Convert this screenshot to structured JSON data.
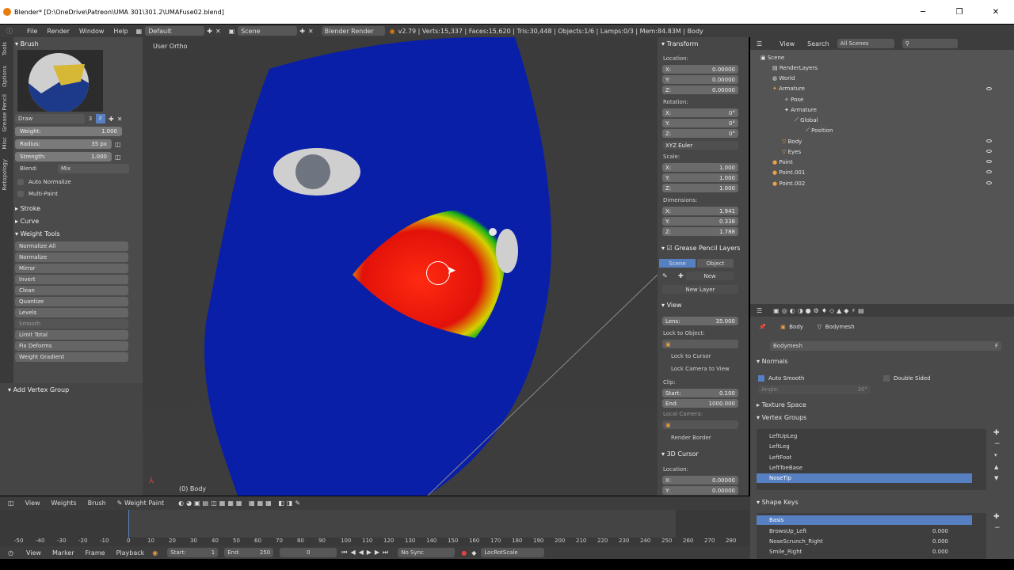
{
  "window": {
    "title": "Blender* [D:\\OneDrive\\Patreon\\UMA 301\\301.2\\UMAFuse02.blend]",
    "minimize": "─",
    "maximize": "❐",
    "close": "✕"
  },
  "menubar": {
    "items": [
      "File",
      "Render",
      "Window",
      "Help"
    ],
    "layout": "Default",
    "scene": "Scene",
    "engine": "Blender Render",
    "stats": "v2.79 | Verts:15,337 | Faces:15,620 | Tris:30,448 | Objects:1/6 | Lamps:0/3 | Mem:84.83M | Body"
  },
  "left_tabs": [
    "Tools",
    "Options",
    "Grease Pencil",
    "Misc",
    "Retopology"
  ],
  "brush": {
    "header": "Brush",
    "name": "Draw",
    "users": "3",
    "fake_user": "F",
    "weight_label": "Weight:",
    "weight": "1.000",
    "radius_label": "Radius:",
    "radius": "35 px",
    "strength_label": "Strength:",
    "strength": "1.000",
    "blend_label": "Blend:",
    "blend": "Mix",
    "auto_normalize": "Auto Normalize",
    "multi_paint": "Multi-Paint"
  },
  "sections": {
    "stroke": "Stroke",
    "curve": "Curve",
    "weight_tools": "Weight Tools",
    "add_vertex_group": "Add Vertex Group"
  },
  "weight_tools": [
    "Normalize All",
    "Normalize",
    "Mirror",
    "Invert",
    "Clean",
    "Quantize",
    "Levels",
    "Smooth",
    "Limit Total",
    "Fix Deforms",
    "Weight Gradient"
  ],
  "viewport": {
    "label": "User Ortho",
    "object": "(0) Body"
  },
  "transform": {
    "header": "Transform",
    "location_label": "Location:",
    "location": [
      "X:",
      "0.00000",
      "Y:",
      "0.00000",
      "Z:",
      "0.00000"
    ],
    "rotation_label": "Rotation:",
    "rotation": [
      "X:",
      "0°",
      "Y:",
      "0°",
      "Z:",
      "0°"
    ],
    "rot_mode": "XYZ Euler",
    "scale_label": "Scale:",
    "scale": [
      "X:",
      "1.000",
      "Y:",
      "1.000",
      "Z:",
      "1.000"
    ],
    "dimensions_label": "Dimensions:",
    "dimensions": [
      "X:",
      "1.941",
      "Y:",
      "0.338",
      "Z:",
      "1.788"
    ]
  },
  "grease": {
    "header": "Grease Pencil Layers",
    "scene": "Scene",
    "object": "Object",
    "new": "New",
    "new_layer": "New Layer"
  },
  "view": {
    "header": "View",
    "lens_label": "Lens:",
    "lens": "35.000",
    "lock_obj": "Lock to Object:",
    "lock_cursor": "Lock to Cursor",
    "lock_camera": "Lock Camera to View",
    "clip": "Clip:",
    "start_label": "Start:",
    "start": "0.100",
    "end_label": "End:",
    "end": "1000.000",
    "local_camera": "Local Camera:",
    "render_border": "Render Border"
  },
  "cursor": {
    "header": "3D Cursor",
    "location": "Location:",
    "x_label": "X:",
    "x": "0.00000",
    "y_label": "Y:",
    "y": "0.00000"
  },
  "outliner": {
    "view": "View",
    "search": "Search",
    "filter": "All Scenes",
    "items": [
      "Scene",
      "RenderLayers",
      "World",
      "Armature",
      "Pose",
      "Armature",
      "Global",
      "Position",
      "Body",
      "Eyes",
      "Point",
      "Point.001",
      "Point.002"
    ]
  },
  "properties": {
    "body": "Body",
    "bodymesh": "Bodymesh",
    "mesh_name": "Bodymesh",
    "mesh_f": "F",
    "normals": "Normals",
    "auto_smooth": "Auto Smooth",
    "double_sided": "Double Sided",
    "angle_label": "Angle:",
    "angle": "30°",
    "texture_space": "Texture Space",
    "vertex_groups": "Vertex Groups",
    "groups": [
      "LeftUpLeg",
      "LeftLeg",
      "LeftFoot",
      "LeftToeBase",
      "NoseTip"
    ],
    "shape_keys": "Shape Keys",
    "keys": [
      {
        "name": "Basis",
        "value": ""
      },
      {
        "name": "BrowsUp_Left",
        "value": "0.000"
      },
      {
        "name": "NoseScrunch_Right",
        "value": "0.000"
      },
      {
        "name": "Smile_Right",
        "value": "0.000"
      }
    ]
  },
  "timeline_header": {
    "items": [
      "View",
      "Weights",
      "Brush"
    ],
    "mode": "Weight Paint"
  },
  "ruler": [
    "-50",
    "-40",
    "-30",
    "-20",
    "-10",
    "0",
    "10",
    "20",
    "30",
    "40",
    "50",
    "60",
    "70",
    "80",
    "90",
    "100",
    "110",
    "120",
    "130",
    "140",
    "150",
    "160",
    "170",
    "180",
    "190",
    "200",
    "210",
    "220",
    "230",
    "240",
    "250",
    "260",
    "270",
    "280"
  ],
  "timeline_bottom": {
    "items": [
      "View",
      "Marker",
      "Frame",
      "Playback"
    ],
    "start_label": "Start:",
    "start": "1",
    "end_label": "End:",
    "end": "250",
    "current": "0",
    "sync": "No Sync",
    "keying": "LocRotScale"
  },
  "colors": {
    "accent": "#5680c2",
    "mesh_blue": "#0a1fa8",
    "paint_red": "#e0140a"
  }
}
